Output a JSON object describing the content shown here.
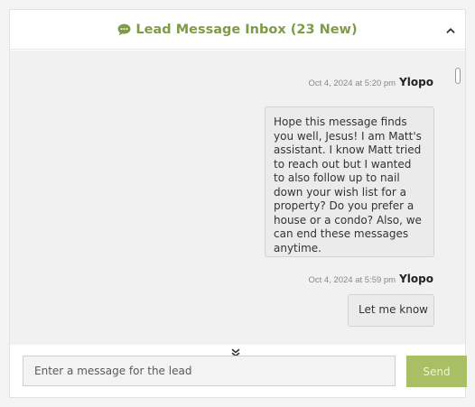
{
  "header": {
    "icon": "chat-bubble-icon",
    "title": "Lead Message Inbox (23 New)",
    "collapse_icon": "chevron-up-icon",
    "accent_color": "#7f9a48"
  },
  "messages": [
    {
      "timestamp": "Oct 4, 2024 at 5:20 pm",
      "sender": "Ylopo",
      "text": "Hope this message finds you well, Jesus! I am Matt's assistant. I know Matt tried to reach out but I wanted to also follow up to nail down your wish list for a property? Do you prefer a house or a condo? Also, we can end these messages anytime."
    },
    {
      "timestamp": "Oct 4, 2024 at 5:59 pm",
      "sender": "Ylopo",
      "text": "Let me know"
    }
  ],
  "scroll_down_icon": "double-chevron-down-icon",
  "composer": {
    "placeholder": "Enter a message for the lead",
    "value": ""
  },
  "send_button": {
    "label": "Send",
    "color": "#a9bf63"
  }
}
